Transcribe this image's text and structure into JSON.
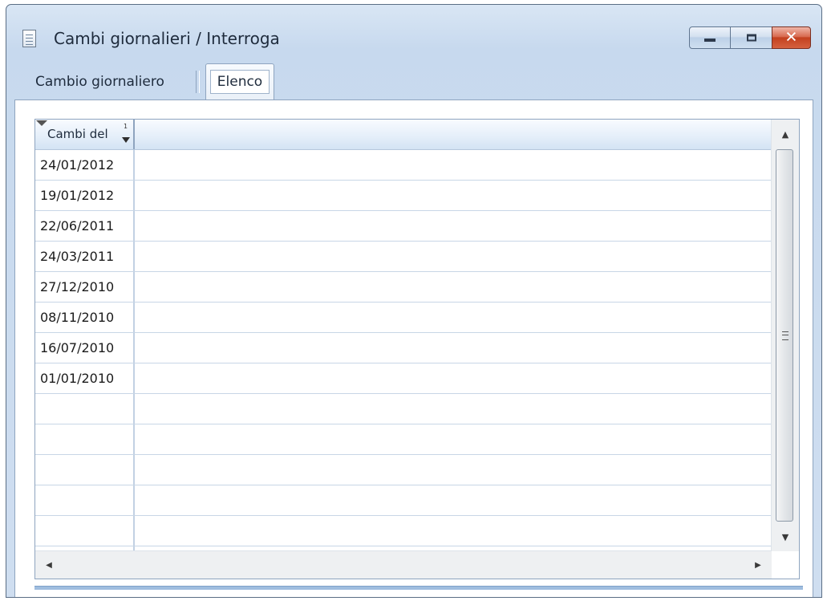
{
  "window": {
    "title": "Cambi giornalieri / Interroga",
    "icon": "document-icon",
    "controls": {
      "minimize": "minimize-icon",
      "maximize": "maximize-icon",
      "close": "✕"
    }
  },
  "tabs": [
    {
      "label": "Cambio giornaliero",
      "active": false
    },
    {
      "label": "Elenco",
      "active": true
    }
  ],
  "grid": {
    "columns": [
      {
        "label": "Cambi del",
        "sort_order": "1",
        "sort_direction": "descending"
      }
    ],
    "rows": [
      "24/01/2012",
      "19/01/2012",
      "22/06/2011",
      "24/03/2011",
      "27/12/2010",
      "08/11/2010",
      "16/07/2010",
      "01/01/2010",
      "",
      "",
      "",
      "",
      "",
      ""
    ],
    "scroll_up_arrow": "▲",
    "scroll_down_arrow": "▼",
    "scroll_left_arrow": "◀",
    "scroll_right_arrow": "▶"
  },
  "colors": {
    "window_frame": "#c7d9ee",
    "header_gradient_end": "#d3e3f4",
    "grid_line": "#c8d6e6",
    "close_button": "#c3401f",
    "status_strip": "#9fbddf"
  }
}
